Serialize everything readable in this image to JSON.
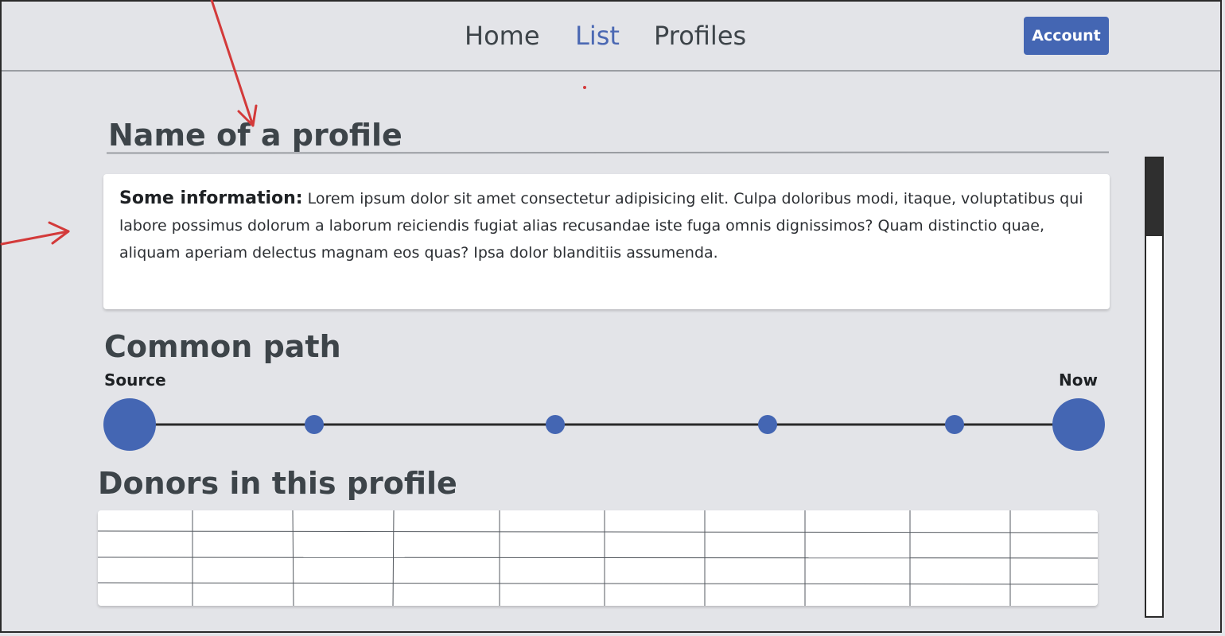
{
  "nav": {
    "links": [
      "Home",
      "List",
      "Profiles"
    ],
    "active": "List",
    "account_label": "Account"
  },
  "profile": {
    "title": "Name of a profile",
    "info_label": "Some information:",
    "info_text": " Lorem ipsum dolor sit amet consectetur adipisicing elit. Culpa doloribus modi, itaque, voluptatibus qui labore possimus dolorum a laborum reiciendis fugiat alias recusandae iste fuga omnis dignissimos? Quam distinctio quae, aliquam aperiam delectus magnam eos quas? Ipsa dolor blanditiis assumenda."
  },
  "common_path": {
    "title": "Common path",
    "start_label": "Source",
    "end_label": "Now",
    "intermediate_nodes": 4
  },
  "donors": {
    "title": "Donors in this profile",
    "columns": 10,
    "rows": 4
  },
  "scroll": {
    "position": 0
  },
  "colors": {
    "accent": "#4466b3",
    "background": "#e3e4e8",
    "annotation": "#d33a3a"
  }
}
